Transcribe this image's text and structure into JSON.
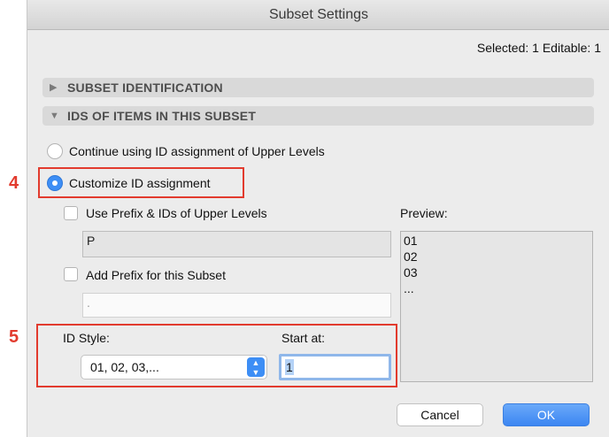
{
  "window": {
    "title": "Subset Settings"
  },
  "selection_info": "Selected: 1 Editable: 1",
  "sections": [
    {
      "label": "SUBSET IDENTIFICATION",
      "expanded": false
    },
    {
      "label": "IDS OF ITEMS IN THIS SUBSET",
      "expanded": true
    }
  ],
  "radios": {
    "continue_label": "Continue using ID assignment of Upper Levels",
    "customize_label": "Customize ID assignment",
    "selected": "customize"
  },
  "use_prefix": {
    "label": "Use Prefix & IDs of Upper Levels",
    "checked": false,
    "field_value": "P"
  },
  "add_prefix": {
    "label": "Add Prefix for this Subset",
    "checked": false,
    "field_value": "."
  },
  "preview": {
    "label": "Preview:",
    "lines": [
      "01",
      "02",
      "03",
      "..."
    ]
  },
  "id_style": {
    "label": "ID Style:",
    "value": "01, 02, 03,..."
  },
  "start_at": {
    "label": "Start at:",
    "value": "1"
  },
  "buttons": {
    "cancel": "Cancel",
    "ok": "OK"
  },
  "annotations": {
    "step4": "4",
    "step5": "5",
    "color": "#e23b2e"
  },
  "colors": {
    "accent": "#3d8ef5"
  }
}
